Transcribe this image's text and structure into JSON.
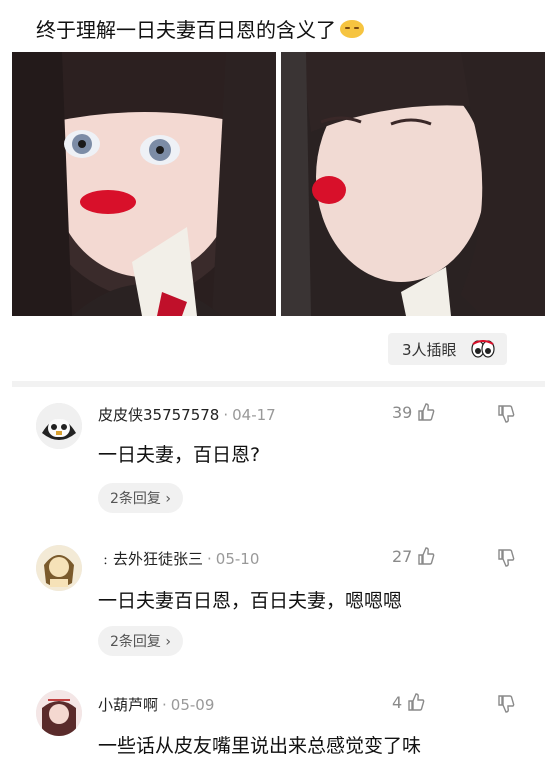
{
  "post": {
    "title": "终于理解一日夫妻百日恩的含义了",
    "title_emoji": "smirk-emoji"
  },
  "images": [
    {
      "name": "selfie-tongue"
    },
    {
      "name": "selfie-kiss"
    }
  ],
  "reaction": {
    "label": "3人插眼",
    "icon": "eyes-icon"
  },
  "comments": [
    {
      "user": "皮皮侠35757578",
      "date": "04-17",
      "likes": "39",
      "text": "一日夫妻，百日恩?",
      "replies": "2条回复 ›"
    },
    {
      "user": "﹕去外狂徒张三",
      "date": "05-10",
      "likes": "27",
      "text": "一日夫妻百日恩，百日夫妻，嗯嗯嗯",
      "replies": "2条回复 ›"
    },
    {
      "user": "小葫芦啊",
      "date": "05-09",
      "likes": "4",
      "text": "一些话从皮友嘴里说出来总感觉变了味"
    }
  ],
  "colors": {
    "accent_red": "#d8102a",
    "meta_gray": "#999999",
    "pill_bg": "#f1f1f1"
  }
}
